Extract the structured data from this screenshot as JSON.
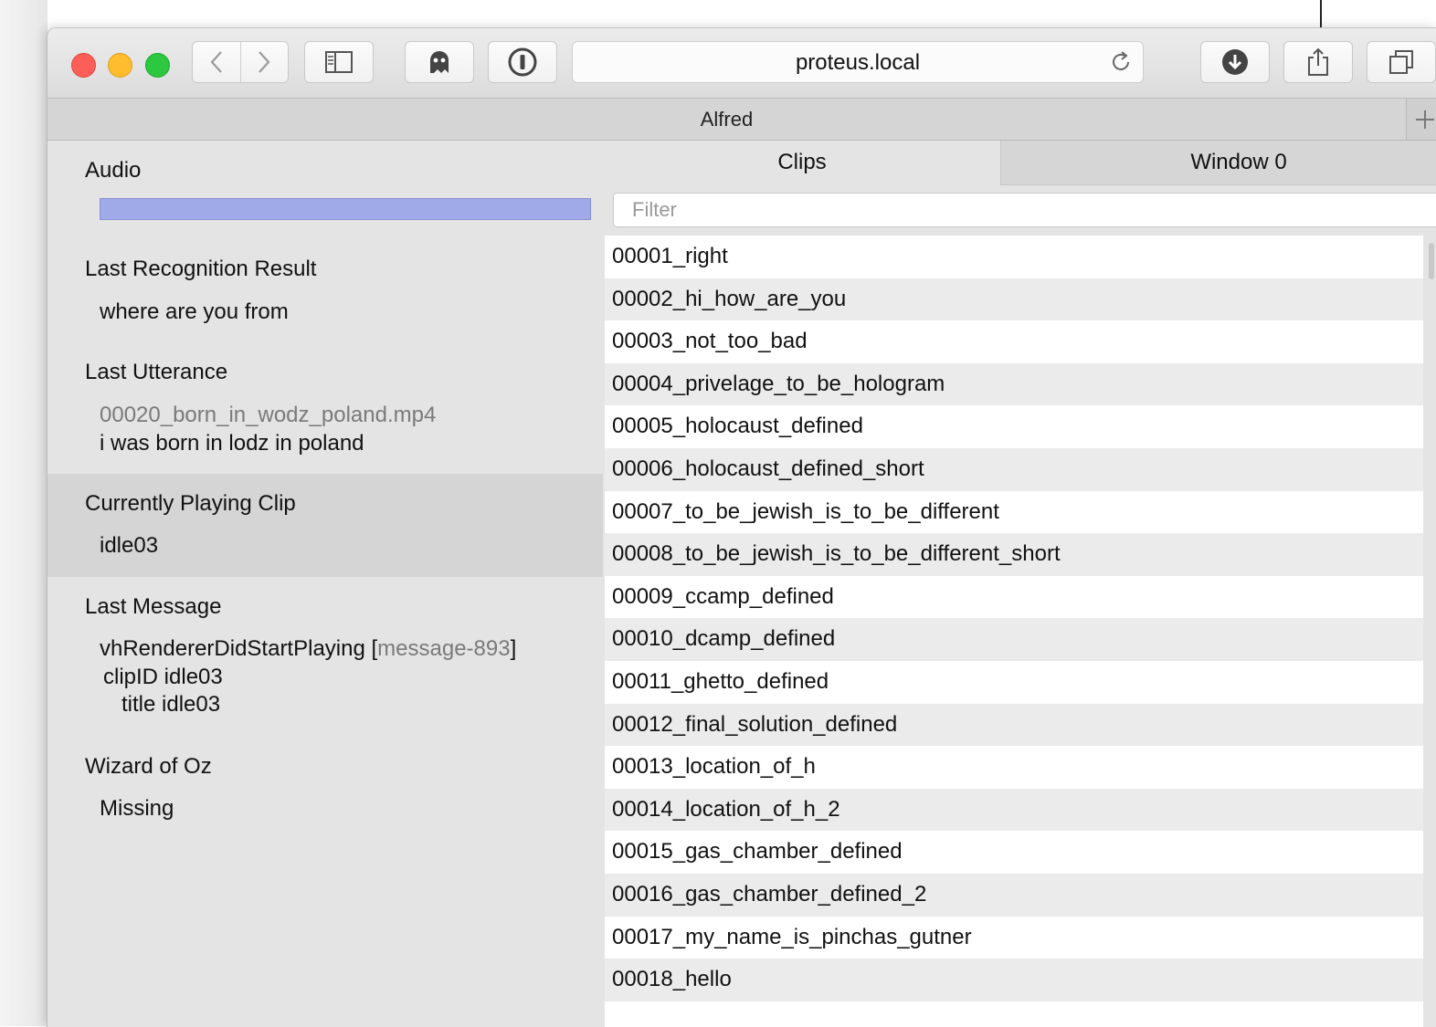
{
  "browser": {
    "address": "proteus.local",
    "tab_title": "Alfred"
  },
  "left": {
    "audio": {
      "label": "Audio",
      "level": 1.0
    },
    "recognition": {
      "label": "Last Recognition Result",
      "value": "where are you from"
    },
    "utterance": {
      "label": "Last Utterance",
      "file": "00020_born_in_wodz_poland.mp4",
      "text": "i was born in lodz in poland"
    },
    "playing": {
      "label": "Currently Playing Clip",
      "value": "idle03"
    },
    "message": {
      "label": "Last Message",
      "name": "vhRendererDidStartPlaying",
      "open_bracket": "[",
      "id": "message-893",
      "close_bracket": "]",
      "line2": "clipID idle03",
      "line3": "title idle03"
    },
    "wizard": {
      "label": "Wizard of Oz",
      "value": "Missing"
    }
  },
  "right": {
    "tabs": [
      "Clips",
      "Window 0"
    ],
    "filter_placeholder": "Filter",
    "clips": [
      "00001_right",
      "00002_hi_how_are_you",
      "00003_not_too_bad",
      "00004_privelage_to_be_hologram",
      "00005_holocaust_defined",
      "00006_holocaust_defined_short",
      "00007_to_be_jewish_is_to_be_different",
      "00008_to_be_jewish_is_to_be_different_short",
      "00009_ccamp_defined",
      "00010_dcamp_defined",
      "00011_ghetto_defined",
      "00012_final_solution_defined",
      "00013_location_of_h",
      "00014_location_of_h_2",
      "00015_gas_chamber_defined",
      "00016_gas_chamber_defined_2",
      "00017_my_name_is_pinchas_gutner",
      "00018_hello"
    ]
  },
  "colors": {
    "audio_fill": "#a1aae9",
    "close": "#fc5f57",
    "minimize": "#febc2e",
    "maximize": "#2bc840"
  }
}
